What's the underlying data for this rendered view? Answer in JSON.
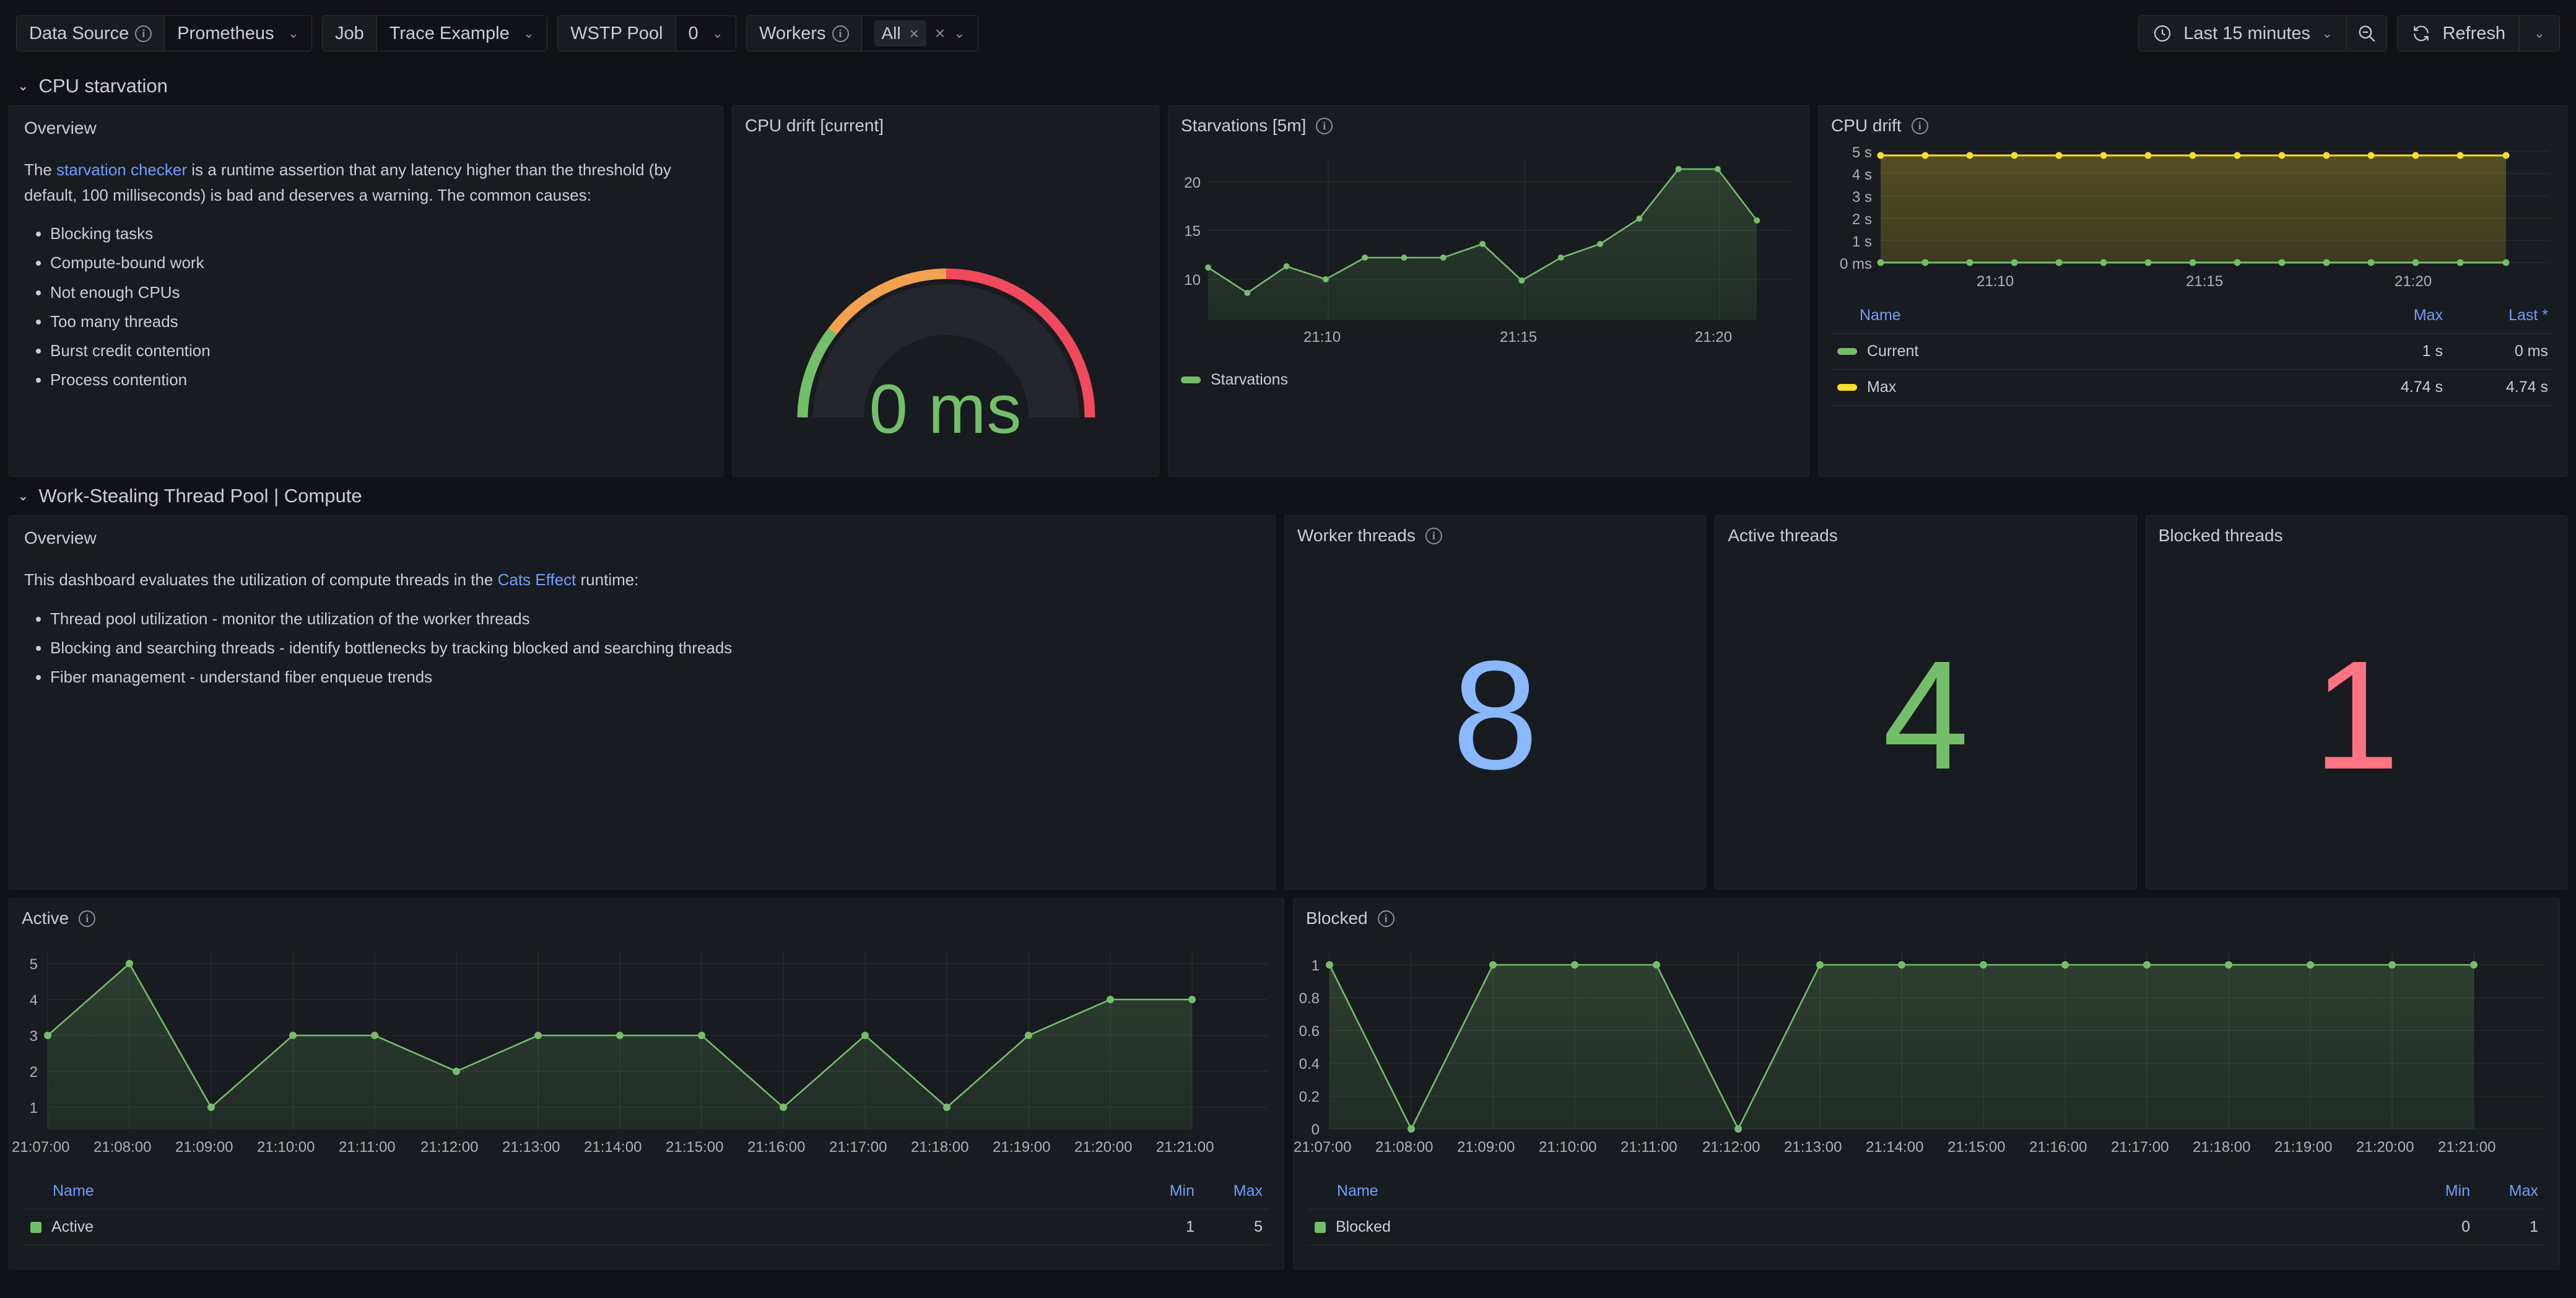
{
  "toolbar": {
    "variables": [
      {
        "label": "Data Source",
        "has_info": true,
        "value": "Prometheus",
        "type": "select"
      },
      {
        "label": "Job",
        "has_info": false,
        "value": "Trace Example",
        "type": "select"
      },
      {
        "label": "WSTP Pool",
        "has_info": false,
        "value": "0",
        "type": "select"
      },
      {
        "label": "Workers",
        "has_info": true,
        "value": "All",
        "type": "multiselect",
        "pill_remove": "×",
        "clear": "×"
      }
    ],
    "time_range": "Last 15 minutes",
    "zoom_out_title": "Zoom out time range",
    "refresh_label": "Refresh"
  },
  "rows": [
    {
      "title": "CPU starvation"
    },
    {
      "title": "Work-Stealing Thread Pool | Compute"
    }
  ],
  "starvation_overview": {
    "title": "Overview",
    "paragraph_pre": "The ",
    "link_text": "starvation checker",
    "paragraph_post": " is a runtime assertion that any latency higher than the threshold (by default, 100 milliseconds) is bad and deserves a warning. The common causes:",
    "bullets": [
      "Blocking tasks",
      "Compute-bound work",
      "Not enough CPUs",
      "Too many threads",
      "Burst credit contention",
      "Process contention"
    ]
  },
  "wstp_overview": {
    "title": "Overview",
    "paragraph_pre": "This dashboard evaluates the utilization of compute threads in the ",
    "link_text": "Cats Effect",
    "paragraph_post": " runtime:",
    "bullets": [
      "Thread pool utilization - monitor the utilization of the worker threads",
      "Blocking and searching threads - identify bottlenecks by tracking blocked and searching threads",
      "Fiber management - understand fiber enqueue trends"
    ]
  },
  "panels": {
    "cpu_drift_gauge": {
      "title": "CPU drift [current]",
      "value_text": "0 ms",
      "value_color": "#73bf69",
      "threshold_colors": {
        "green": "#73bf69",
        "orange": "#f2a24e",
        "red": "#f2495c"
      }
    },
    "starvations": {
      "title": "Starvations [5m]",
      "has_info": true
    },
    "cpu_drift": {
      "title": "CPU drift",
      "has_info": true
    },
    "worker_threads": {
      "title": "Worker threads",
      "has_info": true,
      "value": "8",
      "color": "#8ab8ff"
    },
    "active_threads": {
      "title": "Active threads",
      "has_info": false,
      "value": "4",
      "color": "#73bf69"
    },
    "blocked_threads": {
      "title": "Blocked threads",
      "has_info": false,
      "value": "1",
      "color": "#ff7383"
    },
    "active": {
      "title": "Active",
      "has_info": true
    },
    "blocked": {
      "title": "Blocked",
      "has_info": true
    }
  },
  "chart_data": [
    {
      "id": "starvations",
      "type": "line",
      "title": "Starvations [5m]",
      "xlabel": "",
      "ylabel": "",
      "grid": true,
      "legend_position": "bottom",
      "x": [
        "21:07",
        "21:08",
        "21:09",
        "21:10",
        "21:11",
        "21:12",
        "21:13",
        "21:14",
        "21:15",
        "21:16",
        "21:17",
        "21:18",
        "21:19",
        "21:20",
        "21:21"
      ],
      "xtick_labels": [
        "21:10",
        "21:15",
        "21:20"
      ],
      "ytick_labels": [
        "10",
        "15",
        "20"
      ],
      "ylim": [
        7,
        22.5
      ],
      "series": [
        {
          "name": "Starvations",
          "color": "#73bf69",
          "values": [
            11.2,
            8.6,
            11.3,
            10.0,
            12.2,
            12.2,
            12.2,
            13.6,
            9.9,
            12.2,
            13.6,
            16.2,
            21.3,
            21.3,
            16.0
          ]
        }
      ]
    },
    {
      "id": "cpu_drift",
      "type": "line",
      "title": "CPU drift",
      "xlabel": "",
      "ylabel": "",
      "grid": true,
      "legend_position": "bottom-table",
      "x": [
        "21:07",
        "21:08",
        "21:09",
        "21:10",
        "21:11",
        "21:12",
        "21:13",
        "21:14",
        "21:15",
        "21:16",
        "21:17",
        "21:18",
        "21:19",
        "21:20",
        "21:21"
      ],
      "xtick_labels": [
        "21:10",
        "21:15",
        "21:20"
      ],
      "ytick_labels": [
        "0 ms",
        "1 s",
        "2 s",
        "3 s",
        "4 s",
        "5 s"
      ],
      "ylim": [
        0,
        5
      ],
      "series": [
        {
          "name": "Current",
          "color": "#73bf69",
          "values": [
            0,
            0,
            0,
            0,
            0,
            0,
            0,
            0,
            0,
            0,
            0,
            0,
            0,
            0,
            0
          ]
        },
        {
          "name": "Max",
          "color": "#fade2a",
          "values": [
            4.74,
            4.74,
            4.74,
            4.74,
            4.74,
            4.74,
            4.74,
            4.74,
            4.74,
            4.74,
            4.74,
            4.74,
            4.74,
            4.74,
            4.74
          ]
        }
      ],
      "legend_table": {
        "columns": [
          "Name",
          "Max",
          "Last *"
        ],
        "rows": [
          {
            "name": "Current",
            "color": "#73bf69",
            "values": [
              "1 s",
              "0 ms"
            ]
          },
          {
            "name": "Max",
            "color": "#fade2a",
            "values": [
              "4.74 s",
              "4.74 s"
            ]
          }
        ]
      }
    },
    {
      "id": "active",
      "type": "line",
      "title": "Active",
      "xlabel": "",
      "ylabel": "",
      "grid": true,
      "legend_position": "bottom-table",
      "x": [
        "21:07:00",
        "21:08:00",
        "21:09:00",
        "21:10:00",
        "21:11:00",
        "21:12:00",
        "21:13:00",
        "21:14:00",
        "21:15:00",
        "21:16:00",
        "21:17:00",
        "21:18:00",
        "21:19:00",
        "21:20:00",
        "21:21:00"
      ],
      "xtick_labels": [
        "21:07:00",
        "21:08:00",
        "21:09:00",
        "21:10:00",
        "21:11:00",
        "21:12:00",
        "21:13:00",
        "21:14:00",
        "21:15:00",
        "21:16:00",
        "21:17:00",
        "21:18:00",
        "21:19:00",
        "21:20:00",
        "21:21:00"
      ],
      "ytick_labels": [
        "1",
        "2",
        "3",
        "4",
        "5"
      ],
      "ylim": [
        0.55,
        5.35
      ],
      "series": [
        {
          "name": "Active",
          "color": "#73bf69",
          "values": [
            3,
            5,
            1,
            3,
            3,
            2,
            3,
            3,
            3,
            1,
            3,
            1,
            3,
            4,
            4
          ]
        }
      ],
      "legend_table": {
        "columns": [
          "Name",
          "Min",
          "Max"
        ],
        "rows": [
          {
            "name": "Active",
            "color": "#73bf69",
            "values": [
              "1",
              "5"
            ]
          }
        ]
      }
    },
    {
      "id": "blocked",
      "type": "line",
      "title": "Blocked",
      "xlabel": "",
      "ylabel": "",
      "grid": true,
      "legend_position": "bottom-table",
      "x": [
        "21:07:00",
        "21:08:00",
        "21:09:00",
        "21:10:00",
        "21:11:00",
        "21:12:00",
        "21:13:00",
        "21:14:00",
        "21:15:00",
        "21:16:00",
        "21:17:00",
        "21:18:00",
        "21:19:00",
        "21:20:00",
        "21:21:00"
      ],
      "xtick_labels": [
        "21:07:00",
        "21:08:00",
        "21:09:00",
        "21:10:00",
        "21:11:00",
        "21:12:00",
        "21:13:00",
        "21:14:00",
        "21:15:00",
        "21:16:00",
        "21:17:00",
        "21:18:00",
        "21:19:00",
        "21:20:00",
        "21:21:00"
      ],
      "ytick_labels": [
        "0",
        "0.2",
        "0.4",
        "0.6",
        "0.8",
        "1"
      ],
      "ylim": [
        0,
        1
      ],
      "series": [
        {
          "name": "Blocked",
          "color": "#73bf69",
          "values": [
            1,
            0,
            1,
            1,
            1,
            0,
            1,
            1,
            1,
            1,
            1,
            1,
            1,
            1,
            1
          ]
        }
      ],
      "legend_table": {
        "columns": [
          "Name",
          "Min",
          "Max"
        ],
        "rows": [
          {
            "name": "Blocked",
            "color": "#73bf69",
            "values": [
              "0",
              "1"
            ]
          }
        ]
      }
    }
  ]
}
